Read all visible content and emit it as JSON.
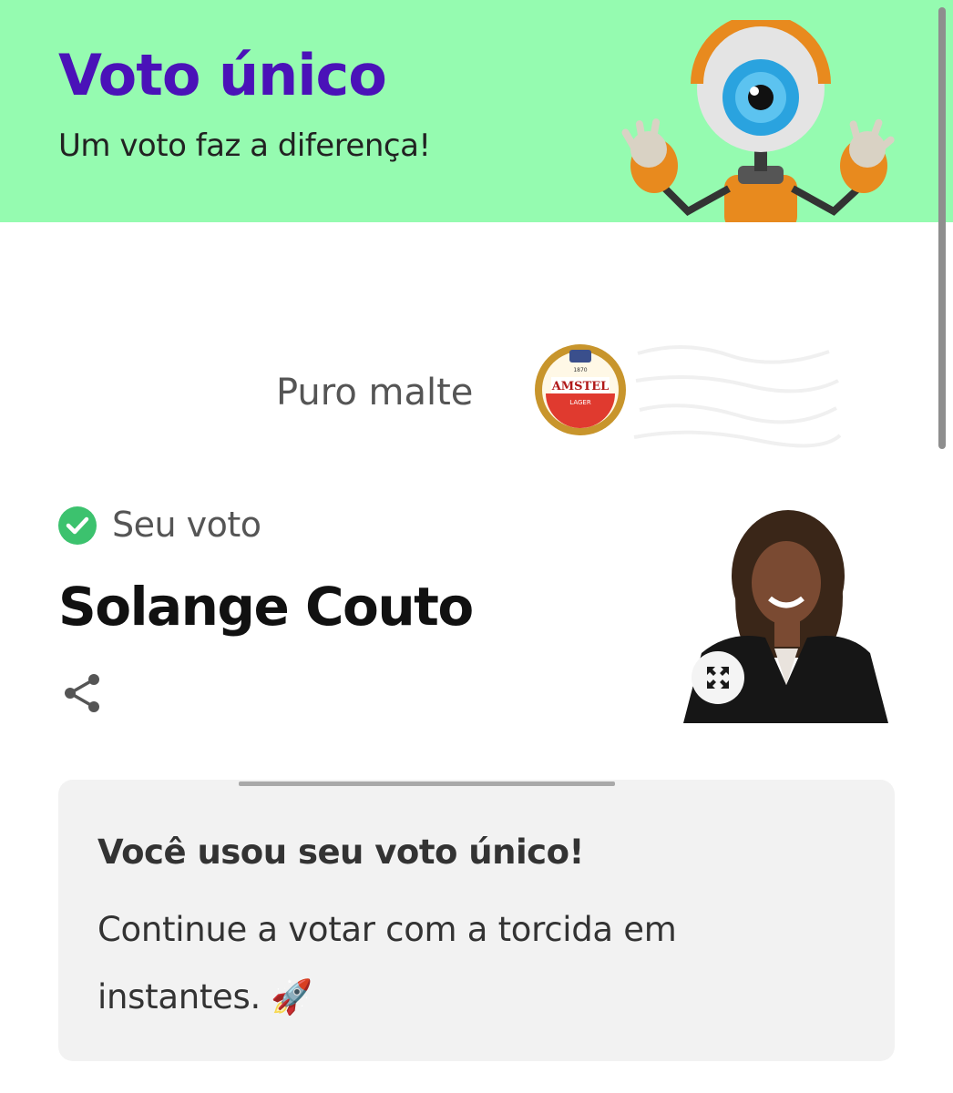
{
  "header": {
    "title": "Voto único",
    "subtitle": "Um voto faz a diferença!",
    "background_color": "#95fbb0",
    "title_color": "#4a12b8",
    "mascot_icon": "big-brother-eye-mascot"
  },
  "sponsor": {
    "text": "Puro malte",
    "logo": {
      "brand": "AMSTEL",
      "sub": "LAGER",
      "year": "1870"
    }
  },
  "vote": {
    "label": "Seu voto",
    "check_color": "#3cc26e",
    "candidate_name": "Solange Couto",
    "share_icon": "share-icon",
    "expand_icon": "expand-icon"
  },
  "message_card": {
    "title": "Você usou seu voto único!",
    "body": "Continue a votar com a torcida em instantes. 🚀"
  }
}
